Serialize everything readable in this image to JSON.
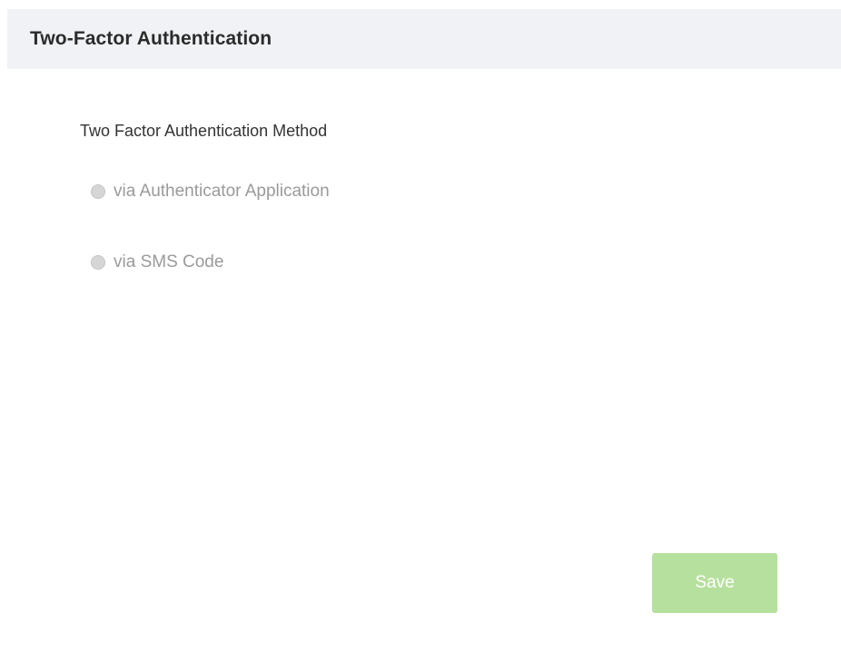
{
  "panel": {
    "title": "Two-Factor Authentication"
  },
  "form": {
    "method_label": "Two Factor Authentication Method",
    "options": [
      {
        "label": "via Authenticator Application",
        "selected": false,
        "disabled": true
      },
      {
        "label": "via SMS Code",
        "selected": false,
        "disabled": true
      }
    ]
  },
  "actions": {
    "save_label": "Save",
    "save_disabled": true
  },
  "colors": {
    "header_bg": "#f0f2f5",
    "save_button_bg": "#b6e09e",
    "disabled_text": "#9a9a9a"
  }
}
